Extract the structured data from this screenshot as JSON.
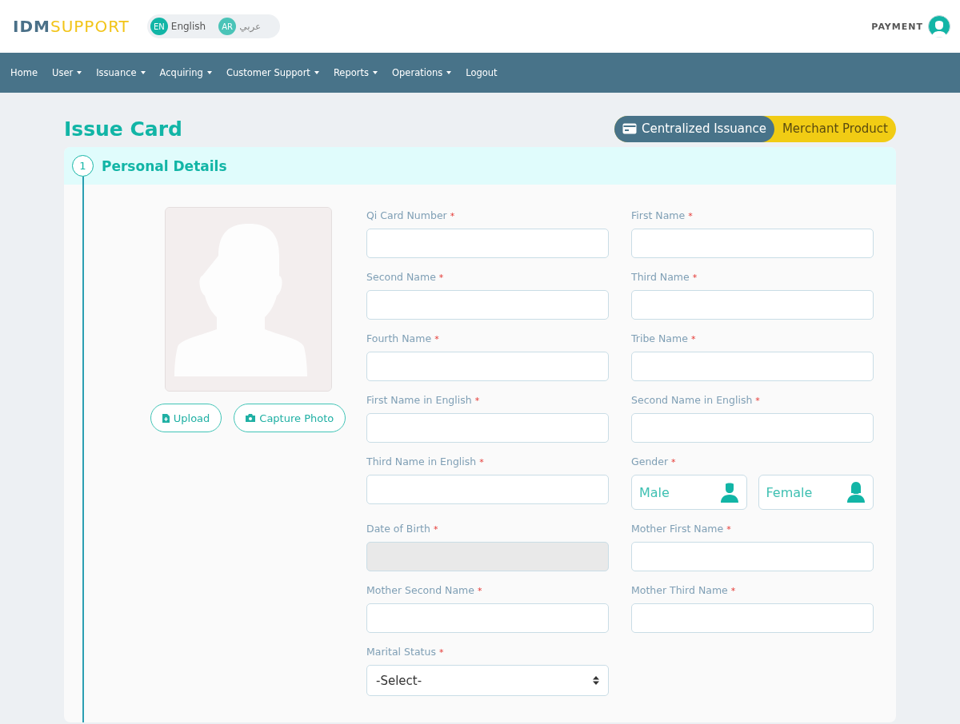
{
  "brand": {
    "part_1": "IDM",
    "part_2": "SUPPORT"
  },
  "language": [
    {
      "code": "EN",
      "label": "English",
      "selected": true
    },
    {
      "code": "AR",
      "label": "عربي",
      "selected": false
    }
  ],
  "user": {
    "name": "PAYMENT"
  },
  "nav": [
    {
      "label": "Home",
      "dropdown": false
    },
    {
      "label": "User",
      "dropdown": true
    },
    {
      "label": "Issuance",
      "dropdown": true
    },
    {
      "label": "Acquiring",
      "dropdown": true
    },
    {
      "label": "Customer Support",
      "dropdown": true
    },
    {
      "label": "Reports",
      "dropdown": true
    },
    {
      "label": "Operations",
      "dropdown": true
    },
    {
      "label": "Logout",
      "dropdown": false
    }
  ],
  "page_title": "Issue Card",
  "mode_switch": [
    {
      "label": "Centralized Issuance",
      "selected": true
    },
    {
      "label": "Merchant Product",
      "selected": false
    }
  ],
  "section": {
    "step": "1",
    "title": "Personal Details"
  },
  "photo_buttons": [
    {
      "label": "Upload",
      "kind": "upload"
    },
    {
      "label": "Capture Photo",
      "kind": "camera"
    }
  ],
  "fields": [
    {
      "label": "Qi Card Number",
      "required_mark": "*",
      "kind": "text"
    },
    {
      "label": "First Name",
      "required_mark": "*",
      "kind": "text"
    },
    {
      "label": "Second Name",
      "required_mark": "*",
      "kind": "text"
    },
    {
      "label": "Third Name",
      "required_mark": "*",
      "kind": "text"
    },
    {
      "label": "Fourth Name",
      "required_mark": "*",
      "kind": "text"
    },
    {
      "label": "Tribe Name",
      "required_mark": "*",
      "kind": "text"
    },
    {
      "label": "First Name in English",
      "required_mark": "*",
      "kind": "text"
    },
    {
      "label": "Second Name in English",
      "required_mark": "*",
      "kind": "text"
    },
    {
      "label": "Third Name in English",
      "required_mark": "*",
      "kind": "text"
    },
    {
      "label": "Gender",
      "required_mark": "*",
      "kind": "gender",
      "options": [
        {
          "label": "Male",
          "kind": "male"
        },
        {
          "label": "Female",
          "kind": "female"
        }
      ]
    },
    {
      "label": "Date of Birth",
      "required_mark": "*",
      "kind": "text",
      "disabled": true
    },
    {
      "label": "Mother First Name",
      "required_mark": "*",
      "kind": "text"
    },
    {
      "label": "Mother Second Name",
      "required_mark": "*",
      "kind": "text"
    },
    {
      "label": "Mother Third Name",
      "required_mark": "*",
      "kind": "text"
    },
    {
      "label": "Marital Status",
      "required_mark": "*",
      "kind": "select",
      "value": "-Select-"
    }
  ]
}
